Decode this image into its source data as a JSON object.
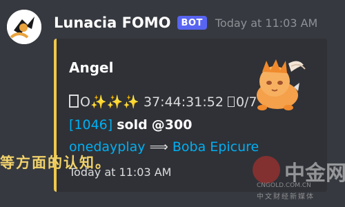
{
  "message": {
    "author": "Lunacia FOMO",
    "badge": "BOT",
    "timestamp": "Today at 11:03 AM"
  },
  "embed": {
    "accent_color": "#f0c94b",
    "title": "Angel",
    "line1": {
      "prefix": "O",
      "stars": "✨✨✨",
      "time": "37:44:31:52",
      "count": "0/7"
    },
    "line2": {
      "id": "[1046]",
      "status": "sold",
      "price": "@300"
    },
    "line3": {
      "seller": "onedayplay",
      "arrow": "⟹",
      "buyer": "Boba Epicure"
    },
    "footer_timestamp": "Today at 11:03 AM",
    "thumbnail": "axie-creature-icon"
  },
  "overlay_text": "等方面的认知。",
  "watermark": {
    "name": "中金网",
    "url": "CNGOLD.COM.CN",
    "subtitle": "中文财经新媒体"
  }
}
